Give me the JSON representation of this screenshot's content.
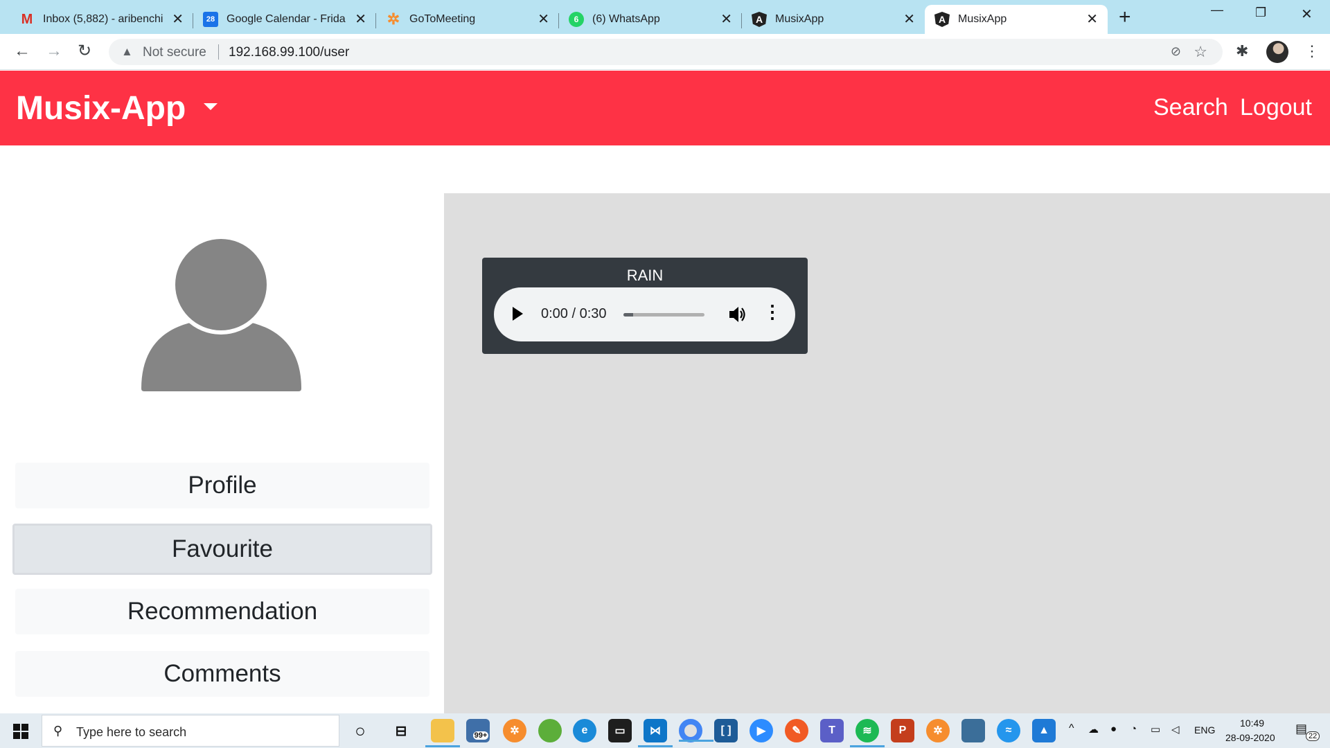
{
  "browser": {
    "tabs": [
      {
        "title": "Inbox (5,882) - aribenchi",
        "favicon": "gmail-icon",
        "active": false
      },
      {
        "title": "Google Calendar - Frida",
        "favicon": "calendar-icon",
        "favicon_text": "28",
        "active": false
      },
      {
        "title": "GoToMeeting",
        "favicon": "gotomeeting-icon",
        "active": false
      },
      {
        "title": "(6) WhatsApp",
        "favicon": "whatsapp-icon",
        "favicon_text": "6",
        "active": false
      },
      {
        "title": "MusixApp",
        "favicon": "angular-icon",
        "favicon_text": "A",
        "active": false
      },
      {
        "title": "MusixApp",
        "favicon": "angular-icon",
        "favicon_text": "A",
        "active": true
      }
    ],
    "address": {
      "security_label": "Not secure",
      "url": "192.168.99.100/user"
    }
  },
  "app": {
    "brand": "Musix-App",
    "nav": {
      "search": "Search",
      "logout": "Logout"
    },
    "sidebar": {
      "items": [
        {
          "label": "Profile",
          "active": false
        },
        {
          "label": "Favourite",
          "active": true
        },
        {
          "label": "Recommendation",
          "active": false
        },
        {
          "label": "Comments",
          "active": false
        }
      ]
    },
    "main": {
      "song": {
        "title": "RAIN",
        "time": "0:00 / 0:30",
        "progress": 0.0
      }
    }
  },
  "taskbar": {
    "search_placeholder": "Type here to search",
    "mail_badge": "99+",
    "notification_badge": "22",
    "language": "ENG",
    "time": "10:49",
    "date": "28-09-2020"
  },
  "colors": {
    "header": "#fe3245",
    "card": "#343a40",
    "main_bg": "#dedede",
    "tab_strip": "#b8e3f2"
  }
}
